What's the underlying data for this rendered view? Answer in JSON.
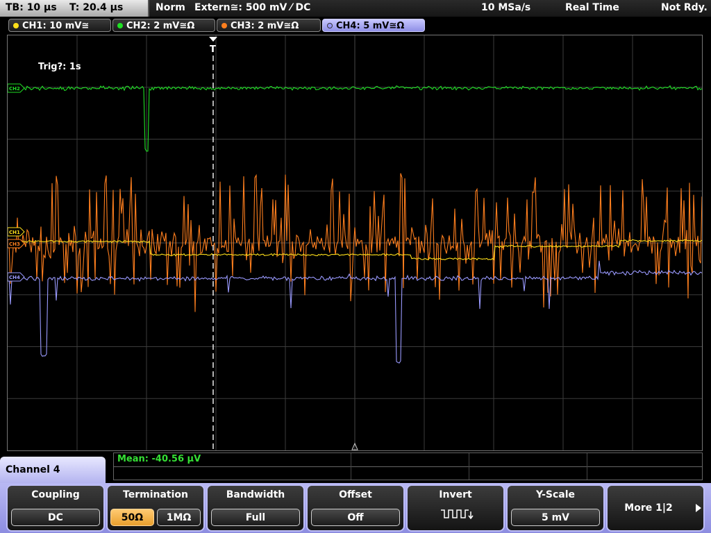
{
  "status_bar": {
    "timebase": "TB: 10 µs",
    "trigger_time": "T: 20.4 µs",
    "trigger_mode": "Norm",
    "trigger_source": "Extern≅: 500 mV ⁄ DC",
    "sample_rate": "10 MSa/s",
    "acquisition": "Real Time",
    "status": "Not Rdy."
  },
  "channels": [
    {
      "label": "CH1: 10 mV≅",
      "color": "#ffe01a",
      "active": false
    },
    {
      "label": "CH2: 2 mV≅Ω",
      "color": "#1fe024",
      "active": false
    },
    {
      "label": "CH3: 2 mV≅Ω",
      "color": "#ff7f1e",
      "active": false
    },
    {
      "label": "CH4: 5 mV≅Ω",
      "color": "#9a9aff",
      "active": true
    }
  ],
  "waveform_markers": [
    "CH2",
    "CH1",
    "CH3",
    "CH4"
  ],
  "trigger_marker": "T",
  "trigger_status": "Trig?: 1s",
  "measurement": {
    "label": "Mean: -40.56 µV"
  },
  "menu": {
    "title": "Channel 4",
    "coupling": {
      "title": "Coupling",
      "value": "DC"
    },
    "termination": {
      "title": "Termination",
      "options": [
        "50Ω",
        "1MΩ"
      ],
      "selected": "50Ω"
    },
    "bandwidth": {
      "title": "Bandwidth",
      "value": "Full"
    },
    "offset": {
      "title": "Offset",
      "value": "Off"
    },
    "invert": {
      "title": "Invert"
    },
    "yscale": {
      "title": "Y-Scale",
      "value": "5 mV"
    },
    "more": {
      "label": "More 1|2"
    }
  },
  "colors": {
    "ch1": "#ffe01a",
    "ch2": "#1fe024",
    "ch3": "#ff7f1e",
    "ch4": "#9a9aff",
    "grid": "#3c3c3c",
    "accent": "#b4b4f0"
  }
}
